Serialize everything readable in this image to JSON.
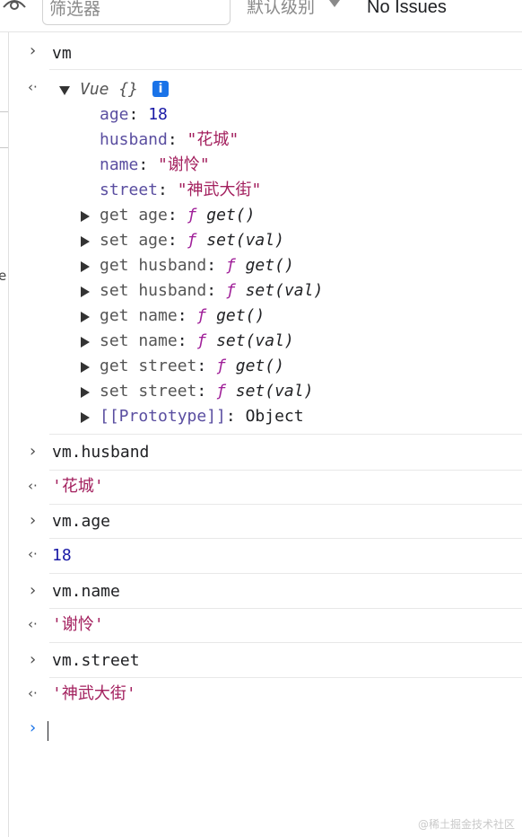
{
  "toolbar": {
    "filter_placeholder": "筛选器",
    "levels_label": "默认级别",
    "issues_label": "No Issues"
  },
  "gutter": {
    "letter": "e"
  },
  "console": {
    "input_glyph": "›",
    "output_glyph": "‹·",
    "entries": [
      {
        "input": "vm"
      },
      {
        "output_object": {
          "class_name": "Vue {}",
          "info": "i",
          "props": [
            {
              "key": "age",
              "value": "18",
              "type": "number"
            },
            {
              "key": "husband",
              "value": "\"花城\"",
              "type": "string"
            },
            {
              "key": "name",
              "value": "\"谢怜\"",
              "type": "string"
            },
            {
              "key": "street",
              "value": "\"神武大街\"",
              "type": "string"
            }
          ],
          "accessors": [
            {
              "key": "get age",
              "fn": "ƒ",
              "sig": "get()"
            },
            {
              "key": "set age",
              "fn": "ƒ",
              "sig": "set(val)"
            },
            {
              "key": "get husband",
              "fn": "ƒ",
              "sig": "get()"
            },
            {
              "key": "set husband",
              "fn": "ƒ",
              "sig": "set(val)"
            },
            {
              "key": "get name",
              "fn": "ƒ",
              "sig": "get()"
            },
            {
              "key": "set name",
              "fn": "ƒ",
              "sig": "set(val)"
            },
            {
              "key": "get street",
              "fn": "ƒ",
              "sig": "get()"
            },
            {
              "key": "set street",
              "fn": "ƒ",
              "sig": "set(val)"
            }
          ],
          "prototype": {
            "key": "[[Prototype]]",
            "value": "Object"
          }
        }
      },
      {
        "input": "vm.husband"
      },
      {
        "output": "'花城'",
        "type": "string"
      },
      {
        "input": "vm.age"
      },
      {
        "output": "18",
        "type": "number"
      },
      {
        "input": "vm.name"
      },
      {
        "output": "'谢怜'",
        "type": "string"
      },
      {
        "input": "vm.street"
      },
      {
        "output": "'神武大街'",
        "type": "string"
      }
    ],
    "prompt_glyph": "›"
  },
  "watermark": "@稀土掘金技术社区",
  "colors": {
    "number": "#1a1aa6",
    "string": "#a3205e",
    "function": "#a02099",
    "prompt": "#1a73e8"
  }
}
